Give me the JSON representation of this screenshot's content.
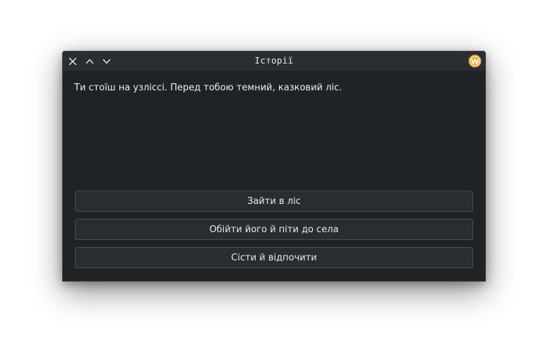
{
  "window": {
    "title": "Історії",
    "controls": {
      "close_icon": "close-icon",
      "maximize_icon": "chevron-up-icon",
      "minimize_icon": "chevron-down-icon",
      "app_icon": "app-logo-icon",
      "app_icon_letter": "W"
    }
  },
  "story": {
    "text": "Ти стоїш на узліссі. Перед тобою темний, казковий ліс.",
    "choices": [
      {
        "label": "Зайти в ліс"
      },
      {
        "label": "Обійти його й піти до села"
      },
      {
        "label": "Сісти й відпочити"
      }
    ]
  },
  "colors": {
    "window_bg": "#202326",
    "titlebar_bg": "#2a2e32",
    "button_bg": "#292c30",
    "button_border": "#494e54",
    "text": "#eceff1",
    "app_icon_accent": "#e6a53a"
  }
}
